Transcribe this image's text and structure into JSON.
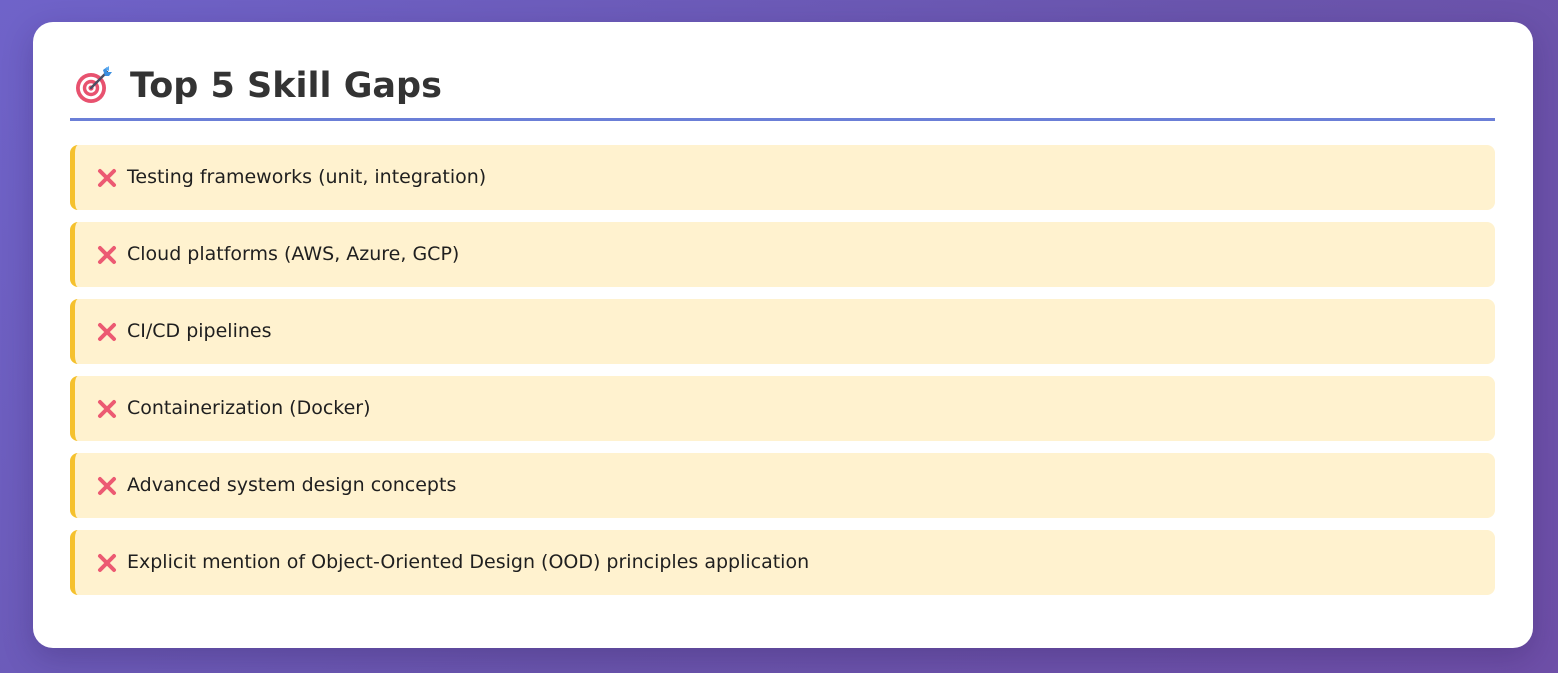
{
  "header": {
    "icon": "target-icon",
    "title": "Top 5 Skill Gaps"
  },
  "gaps": [
    {
      "icon": "cross-icon",
      "text": "Testing frameworks (unit, integration)"
    },
    {
      "icon": "cross-icon",
      "text": "Cloud platforms (AWS, Azure, GCP)"
    },
    {
      "icon": "cross-icon",
      "text": "CI/CD pipelines"
    },
    {
      "icon": "cross-icon",
      "text": "Containerization (Docker)"
    },
    {
      "icon": "cross-icon",
      "text": "Advanced system design concepts"
    },
    {
      "icon": "cross-icon",
      "text": "Explicit mention of Object-Oriented Design (OOD) principles application"
    }
  ],
  "colors": {
    "accent_rule": "#6b7fd7",
    "item_background": "#fff2cf",
    "item_border": "#f5c12e",
    "cross": "#ec5a72"
  }
}
